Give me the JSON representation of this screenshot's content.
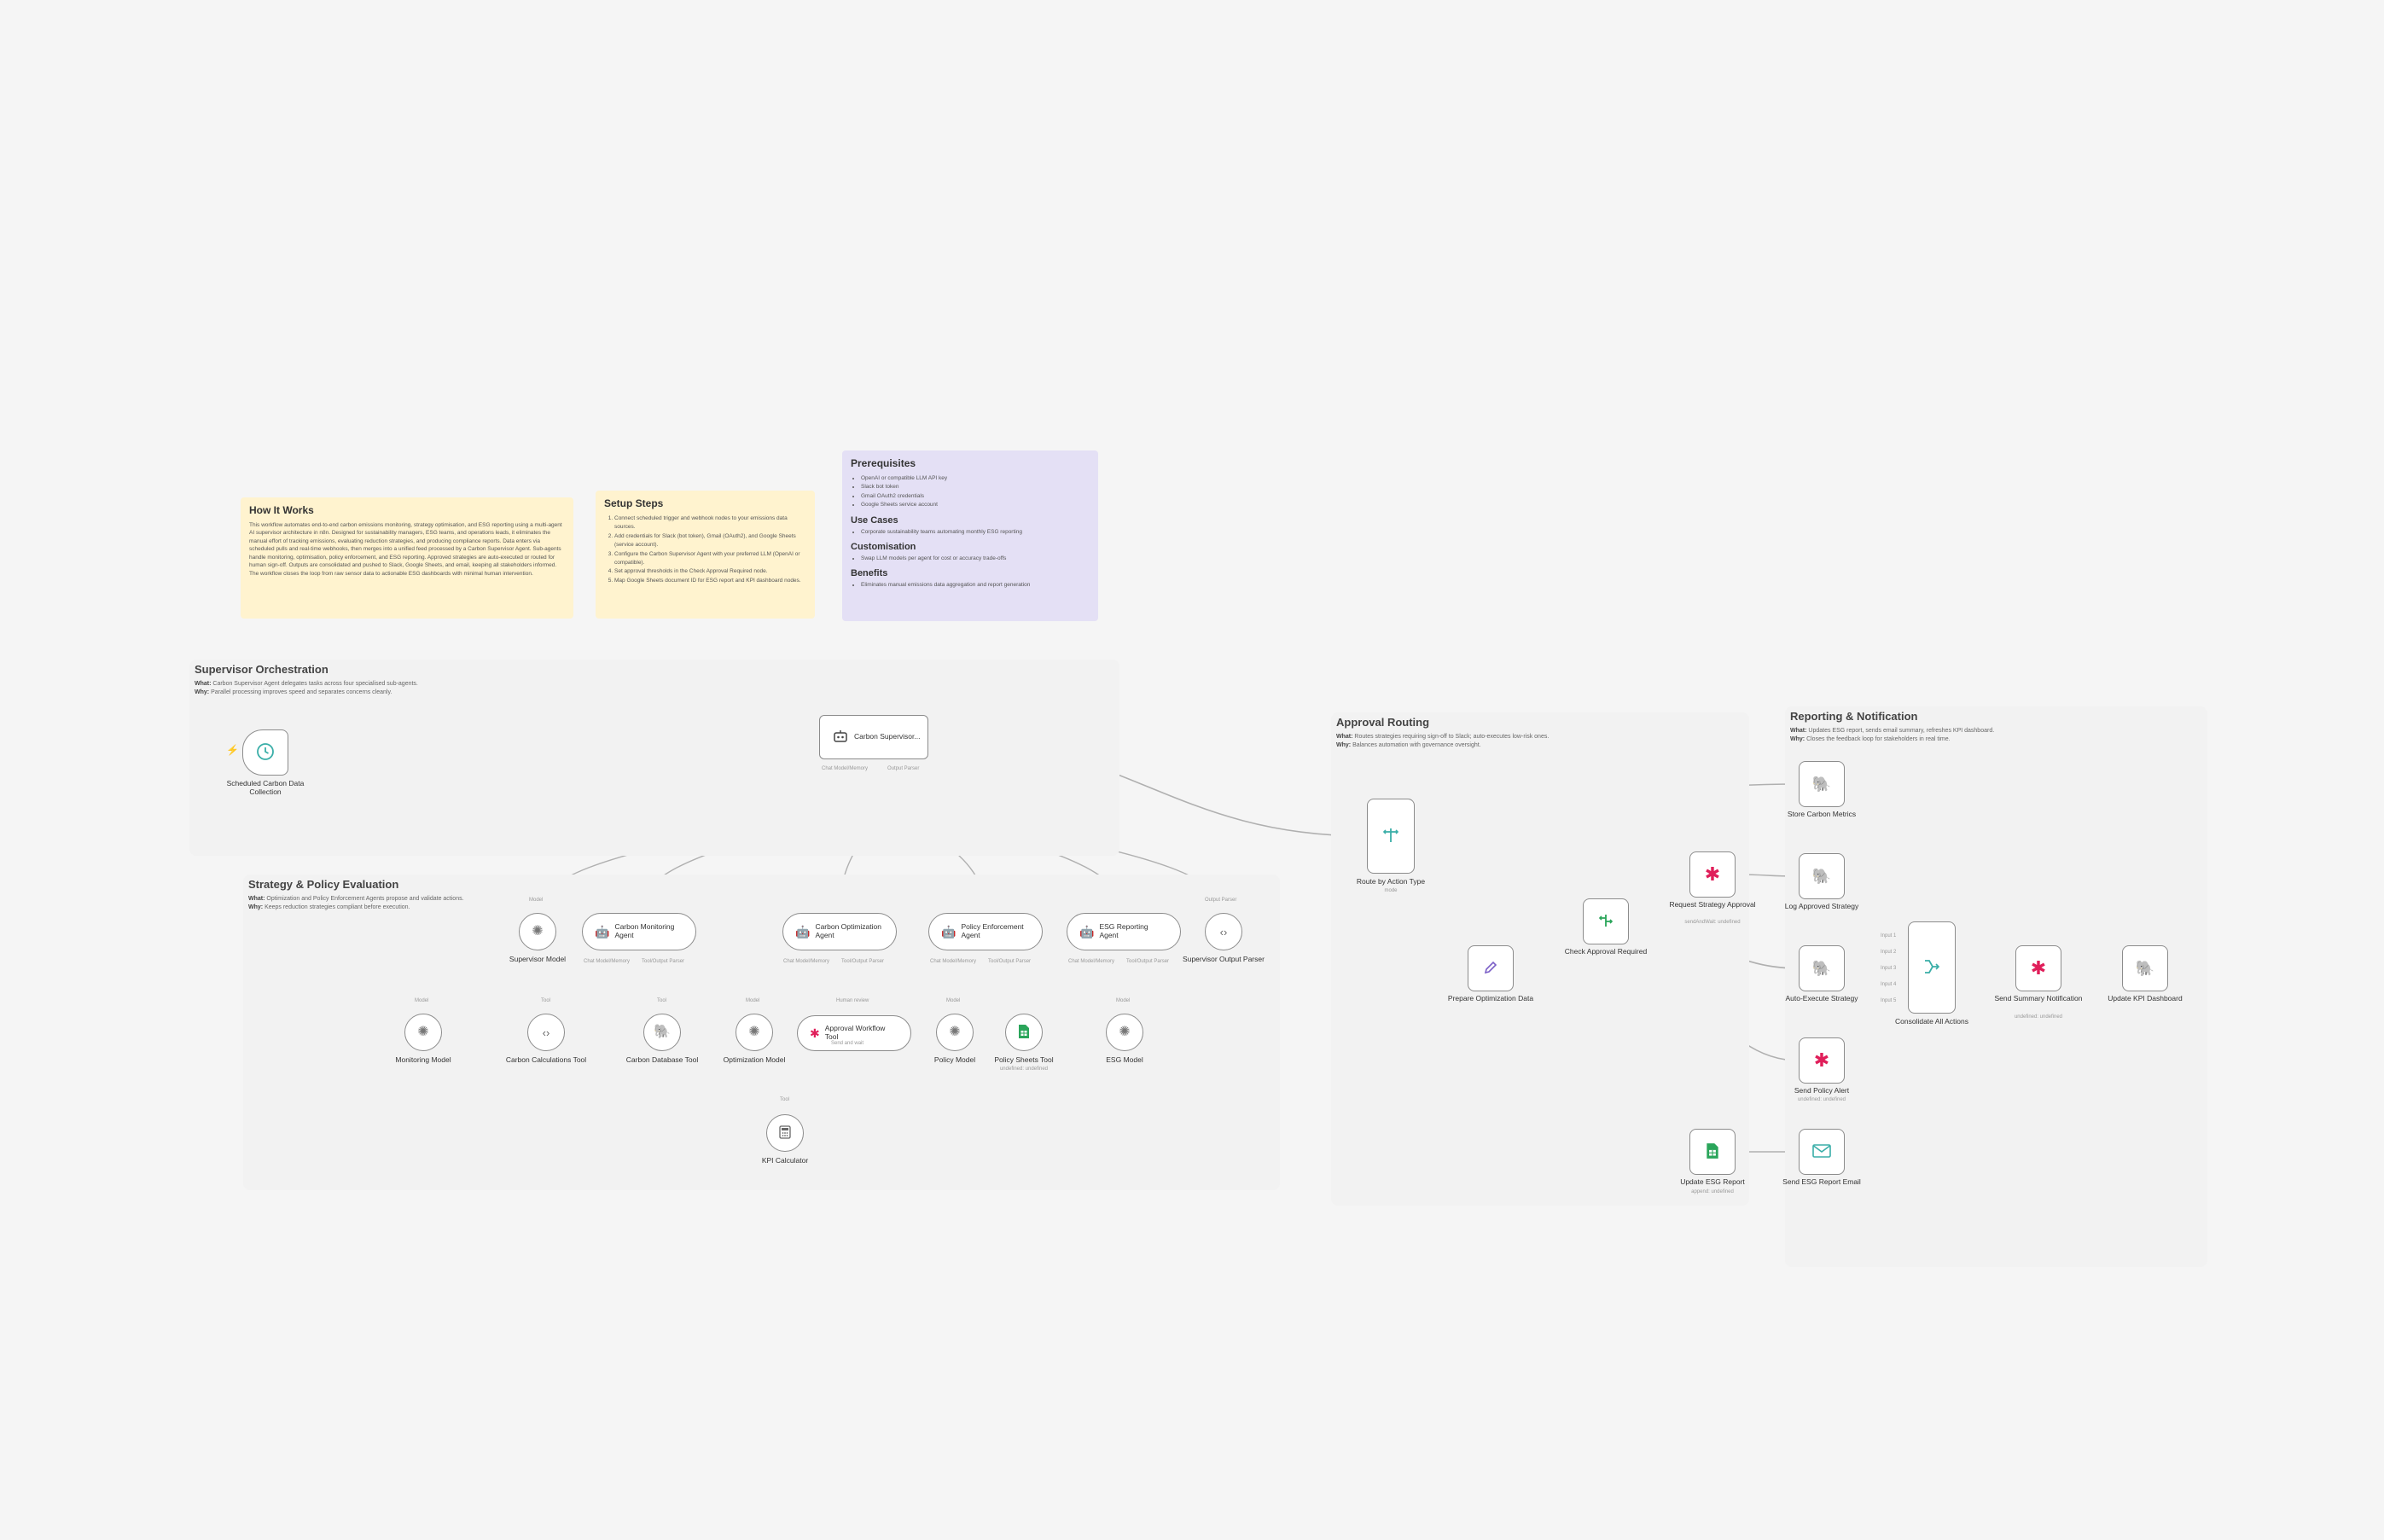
{
  "colors": {
    "background": "#f5f5f5",
    "section_bg": "#f2f2f2",
    "note_yellow": "#fff3cf",
    "note_purple": "#e4e0f5",
    "node_border": "#8c8c8c",
    "edge": "#b0b0b0",
    "icon_teal": "#3aaea8",
    "icon_green": "#2aa55a",
    "icon_purple": "#7b5fc7",
    "icon_postgres": "#336791"
  },
  "notes": {
    "how_it_works": {
      "title": "How It Works",
      "body": "This workflow automates end-to-end carbon emissions monitoring, strategy optimisation, and ESG reporting using a multi-agent AI supervisor architecture in n8n. Designed for sustainability managers, ESG teams, and operations leads, it eliminates the manual effort of tracking emissions, evaluating reduction strategies, and producing compliance reports. Data enters via scheduled pulls and real-time webhooks, then merges into a unified feed processed by a Carbon Supervisor Agent. Sub-agents handle monitoring, optimisation, policy enforcement, and ESG reporting. Approved strategies are auto-executed or routed for human sign-off. Outputs are consolidated and pushed to Slack, Google Sheets, and email, keeping all stakeholders informed. The workflow closes the loop from raw sensor data to actionable ESG dashboards with minimal human intervention."
    },
    "setup_steps": {
      "title": "Setup Steps",
      "items": [
        "Connect scheduled trigger and webhook nodes to your emissions data sources.",
        "Add credentials for Slack (bot token), Gmail (OAuth2), and Google Sheets (service account).",
        "Configure the Carbon Supervisor Agent with your preferred LLM (OpenAI or compatible).",
        "Set approval thresholds in the Check Approval Required node.",
        "Map Google Sheets document ID for ESG report and KPI dashboard nodes."
      ]
    },
    "prereq": {
      "title": "Prerequisites",
      "items": [
        "OpenAI or compatible LLM API key",
        "Slack bot token",
        "Gmail OAuth2 credentials",
        "Google Sheets service account"
      ],
      "use_cases_title": "Use Cases",
      "use_cases": [
        "Corporate sustainability teams automating monthly ESG reporting"
      ],
      "custom_title": "Customisation",
      "custom": [
        "Swap LLM models per agent for cost or accuracy trade-offs"
      ],
      "benefits_title": "Benefits",
      "benefits": [
        "Eliminates manual emissions data aggregation and report generation"
      ]
    }
  },
  "sections": {
    "supervisor": {
      "title": "Supervisor Orchestration",
      "what_label": "What:",
      "what": "Carbon Supervisor Agent delegates tasks across four specialised sub-agents.",
      "why_label": "Why:",
      "why": "Parallel processing improves speed and separates concerns cleanly."
    },
    "strategy": {
      "title": "Strategy & Policy Evaluation",
      "what_label": "What:",
      "what": "Optimization and Policy Enforcement Agents propose and validate actions.",
      "why_label": "Why:",
      "why": "Keeps reduction strategies compliant before execution."
    },
    "approval": {
      "title": "Approval Routing",
      "what_label": "What:",
      "what": "Routes strategies requiring sign-off to Slack; auto-executes low-risk ones.",
      "why_label": "Why:",
      "why": "Balances automation with governance oversight."
    },
    "reporting": {
      "title": "Reporting & Notification",
      "what_label": "What:",
      "what": "Updates ESG report, sends email summary, refreshes KPI dashboard.",
      "why_label": "Why:",
      "why": "Closes the feedback loop for stakeholders in real time."
    }
  },
  "nodes": {
    "trigger": {
      "label": "Scheduled Carbon Data Collection",
      "icon": "clock-icon"
    },
    "supervisor": {
      "label": "Carbon Supervisor...",
      "icon": "robot-icon",
      "port_left": "Chat Model/Memory",
      "port_right": "Output Parser"
    },
    "supervisor_model": {
      "label": "Supervisor Model",
      "port": "Model"
    },
    "monitoring_agent": {
      "label": "Carbon Monitoring Agent",
      "port_left": "Chat Model/Memory",
      "port_right": "Tool/Output Parser"
    },
    "optimization_agent": {
      "label": "Carbon Optimization Agent",
      "port_left": "Chat Model/Memory",
      "port_right": "Tool/Output Parser"
    },
    "policy_agent": {
      "label": "Policy Enforcement Agent",
      "port_left": "Chat Model/Memory",
      "port_right": "Tool/Output Parser"
    },
    "esg_agent": {
      "label": "ESG Reporting Agent",
      "port_left": "Chat Model/Memory",
      "port_right": "Tool/Output Parser"
    },
    "supervisor_parser": {
      "label": "Supervisor Output Parser",
      "port": "Output Parser"
    },
    "monitoring_model": {
      "label": "Monitoring Model",
      "port": "Model"
    },
    "calc_tool": {
      "label": "Carbon Calculations Tool",
      "port": "Tool"
    },
    "db_tool": {
      "label": "Carbon Database Tool",
      "port": "Tool"
    },
    "optimization_model": {
      "label": "Optimization Model",
      "port": "Model"
    },
    "approval_tool": {
      "label": "Approval Workflow Tool",
      "sub": "Send and wait",
      "port": "Human review"
    },
    "policy_model": {
      "label": "Policy Model",
      "port": "Model"
    },
    "policy_sheets": {
      "label": "Policy Sheets Tool",
      "sub": "undefined: undefined"
    },
    "esg_model": {
      "label": "ESG Model",
      "port": "Model"
    },
    "kpi_calc": {
      "label": "KPI Calculator",
      "port": "Tool"
    },
    "route": {
      "label": "Route by Action Type",
      "sub": "mode"
    },
    "prepare": {
      "label": "Prepare Optimization Data"
    },
    "check": {
      "label": "Check Approval Required"
    },
    "request": {
      "label": "Request Strategy Approval",
      "sub": "sendAndWait: undefined"
    },
    "update_esg": {
      "label": "Update ESG Report",
      "sub": "append: undefined"
    },
    "store": {
      "label": "Store Carbon Metrics"
    },
    "log": {
      "label": "Log Approved Strategy"
    },
    "auto": {
      "label": "Auto-Execute Strategy"
    },
    "alert": {
      "label": "Send Policy Alert",
      "sub": "undefined: undefined"
    },
    "email": {
      "label": "Send ESG Report Email"
    },
    "consolidate": {
      "label": "Consolidate All Actions",
      "inputs": [
        "Input 1",
        "Input 2",
        "Input 3",
        "Input 4",
        "Input 5"
      ]
    },
    "summary": {
      "label": "Send Summary Notification",
      "sub": "undefined: undefined"
    },
    "kpi_dash": {
      "label": "Update KPI Dashboard"
    }
  }
}
